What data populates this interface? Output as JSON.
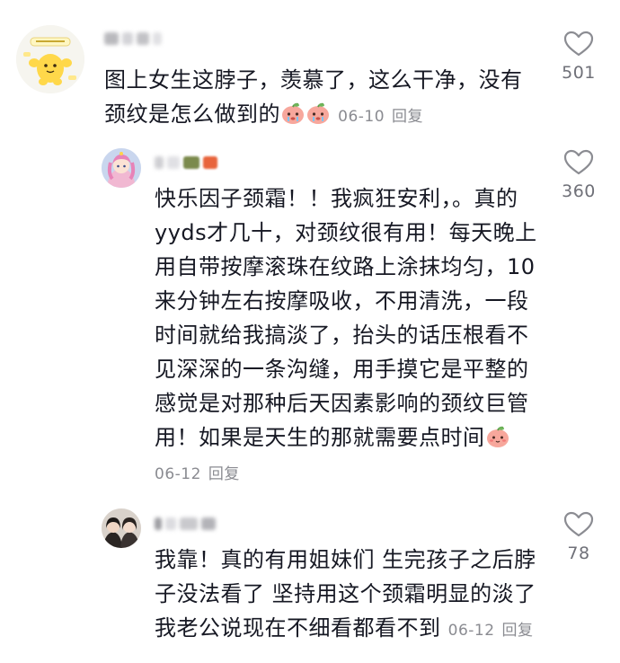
{
  "comments": [
    {
      "username": "•••",
      "text": "图上女生这脖子，羡慕了，这么干净，没有颈纹是怎么做到的",
      "emojis": [
        "crying-peach-emoji",
        "crying-peach-emoji"
      ],
      "date": "06-10",
      "reply_label": "回复",
      "likes": "501"
    },
    {
      "username": "•••",
      "text": "快乐因子颈霜！！我疯狂安利，。真的yyds才几十，对颈纹很有用！每天晚上用自带按摩滚珠在纹路上涂抹均匀，10来分钟左右按摩吸收，不用清洗，一段时间就给我搞淡了，抬头的话压根看不见深深的一条沟缝，用手摸它是平整的感觉是对那种后天因素影响的颈纹巨管用！如果是天生的那就需要点时间",
      "emojis": [
        "peach-emoji"
      ],
      "date": "06-12",
      "reply_label": "回复",
      "likes": "360"
    },
    {
      "username": "•••",
      "text": "我靠！真的有用姐妹们 生完孩子之后脖子没法看了 坚持用这个颈霜明显的淡了我老公说现在不细看都看不到",
      "emojis": [],
      "date": "06-12",
      "reply_label": "回复",
      "likes": "78"
    }
  ],
  "icons": {
    "like": "heart-outline-icon",
    "emoji_crying": "crying-peach-emoji",
    "emoji_peach": "peach-emoji"
  },
  "colors": {
    "text": "#161823",
    "meta": "#8a8b91",
    "like_count": "#6f7078",
    "heart_stroke": "#8b8c92",
    "peach": "#f7a79c"
  }
}
